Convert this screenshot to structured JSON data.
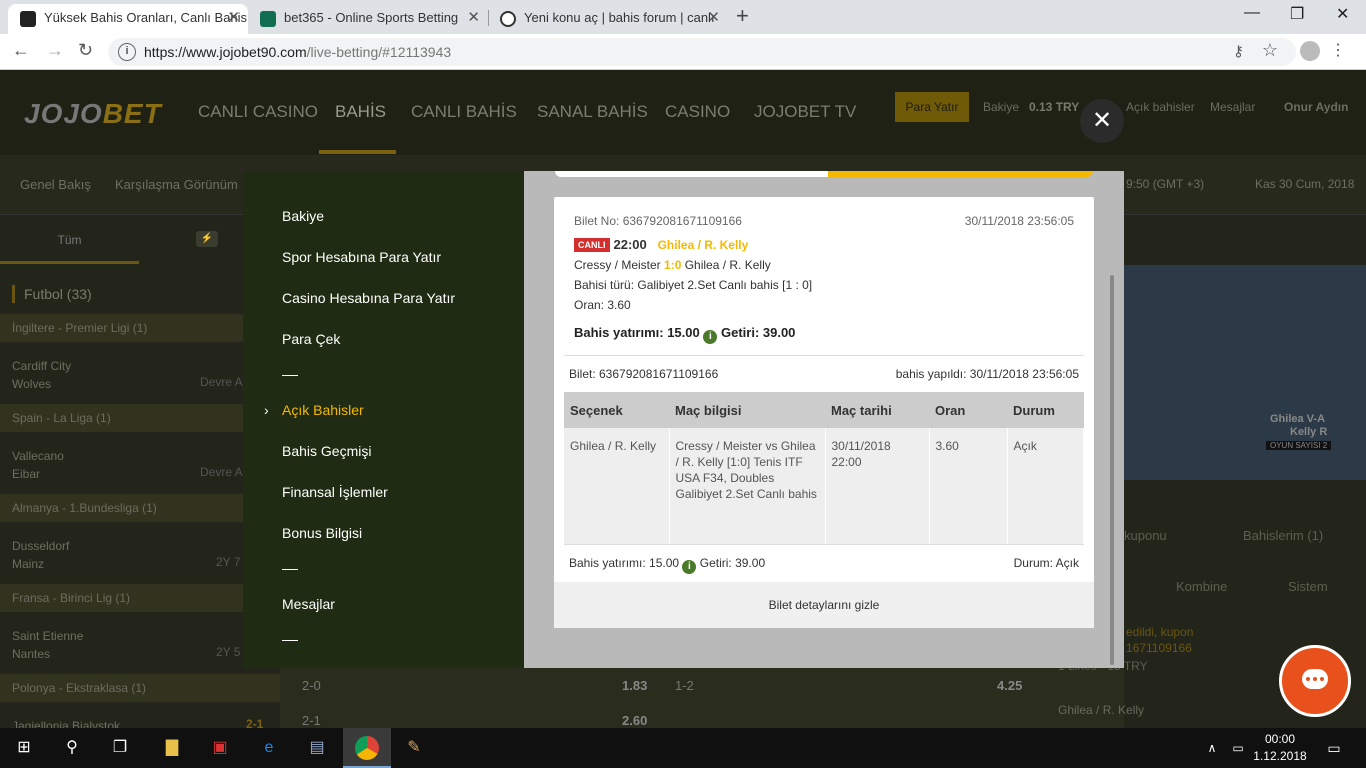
{
  "browser": {
    "tabs": [
      {
        "title": "Yüksek Bahis Oranları, Canlı Bahis"
      },
      {
        "title": "bet365 - Online Sports Betting"
      },
      {
        "title": "Yeni konu aç | bahis forum | canlı"
      }
    ],
    "url_main": "https://www.jojobet90.com",
    "url_path": "/live-betting/#12113943"
  },
  "site": {
    "logo_a": "JOJO",
    "logo_b": "BET",
    "nav": [
      "CANLI CASINO",
      "BAHİS",
      "CANLI BAHİS",
      "SANAL BAHİS",
      "CASINO",
      "JOJOBET TV"
    ],
    "para_yatir": "Para Yatır",
    "bakiye_label": "Bakiye",
    "bakiye_value": "0.13 TRY",
    "acik_bahisler": "Açık bahisler",
    "mesajlar": "Mesajlar",
    "user": "Onur Aydın",
    "subnav": [
      "Genel Bakış",
      "Karşılaşma Görünüm"
    ],
    "time": "9:50  (GMT +3)",
    "date": "Kas 30 Cum, 2018",
    "left_tab": "Tüm",
    "sport": "Futbol (33)",
    "leagues": [
      "İngiltere - Premier Ligi (1)",
      "Spain - La Liga (1)",
      "Almanya - 1.Bundesliga (1)",
      "Fransa - Birinci Lig (1)",
      "Polonya - Ekstraklasa (1)"
    ],
    "matches": [
      {
        "home": "Cardiff City",
        "away": "Wolves",
        "status": "Devre A"
      },
      {
        "home": "Vallecano",
        "away": "Eibar",
        "status": "Devre A"
      },
      {
        "home": "Dusseldorf",
        "away": "Mainz",
        "status": "2Y 7"
      },
      {
        "home": "Saint Etienne",
        "away": "Nantes",
        "status": "2Y 5"
      },
      {
        "home": "Jagiellonia Bialystok",
        "away": "",
        "status": "2-1"
      }
    ],
    "bottom": {
      "r1a": "2-0",
      "r1b": "1.83",
      "r1c": "1-2",
      "r1d": "4.25",
      "r2a": "2-1",
      "r2b": "2.60"
    },
    "right": {
      "kupon": "kuponu",
      "bahislerim": "Bahislerim (1)",
      "kombine": "Kombine",
      "sistem": "Sistem",
      "msg1": "edildi, kupon",
      "msg2": "1671109166",
      "lines": "1 Lines - 15 TRY",
      "match": "Ghilea / R. Kelly",
      "court_a": "Ghilea V-A",
      "court_b": "Kelly R",
      "oyun": "OYUN SAYISI  2"
    }
  },
  "menu": {
    "items": [
      "Bakiye",
      "Spor Hesabına Para Yatır",
      "Casino Hesabına Para Yatır",
      "Para Çek",
      "Açık Bahisler",
      "Bahis Geçmişi",
      "Finansal İşlemler",
      "Bonus Bilgisi",
      "Mesajlar"
    ],
    "sep": "—"
  },
  "ticket": {
    "no_label": "Bilet No:",
    "no": "636792081671109166",
    "datetime": "30/11/2018 23:56:05",
    "canli": "CANLI",
    "time": "22:00",
    "match": "Ghilea / R. Kelly",
    "line1_a": "Cressy / Meister",
    "line1_score": "1:0",
    "line1_b": "Ghilea / R. Kelly",
    "bet_type": "Bahisi türü: Galibiyet 2.Set Canlı bahis  [1 : 0]",
    "oran": "Oran: 3.60",
    "stake": "Bahis yatırımı: 15.00",
    "getiri": "Getiri: 39.00",
    "bilet_label": "Bilet: 636792081671109166",
    "placed": "bahis yapıldı: 30/11/2018 23:56:05",
    "headers": [
      "Seçenek",
      "Maç bilgisi",
      "Maç tarihi",
      "Oran",
      "Durum"
    ],
    "row": {
      "secenek": "Ghilea / R. Kelly",
      "mac": "Cressy / Meister vs Ghilea / R. Kelly [1:0] Tenis ITF USA F34, Doubles Galibiyet 2.Set Canlı bahis",
      "tarih": "30/11/2018 22:00",
      "oran": "3.60",
      "durum": "Açık"
    },
    "foot_stake": "Bahis yatırımı: 15.00",
    "foot_getiri": "Getiri: 39.00",
    "foot_durum": "Durum:  Açık",
    "hide": "Bilet detaylarını gizle"
  },
  "taskbar": {
    "time": "00:00",
    "date": "1.12.2018"
  }
}
